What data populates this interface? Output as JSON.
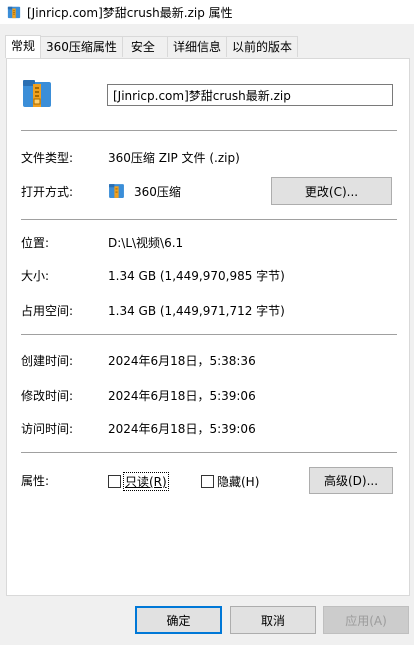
{
  "window": {
    "title": "[Jinricp.com]梦甜crush最新.zip 属性"
  },
  "tabs": [
    {
      "label": "常规",
      "active": true
    },
    {
      "label": "360压缩属性"
    },
    {
      "label": "安全"
    },
    {
      "label": "详细信息"
    },
    {
      "label": "以前的版本"
    }
  ],
  "general": {
    "filename": "[Jinricp.com]梦甜crush最新.zip",
    "file_type_label": "文件类型:",
    "file_type_value": "360压缩 ZIP 文件 (.zip)",
    "open_with_label": "打开方式:",
    "open_with_value": "360压缩",
    "change_button": "更改(C)...",
    "location_label": "位置:",
    "location_value": "D:\\L\\视频\\6.1",
    "size_label": "大小:",
    "size_value": "1.34 GB (1,449,970,985 字节)",
    "size_on_disk_label": "占用空间:",
    "size_on_disk_value": "1.34 GB (1,449,971,712 字节)",
    "created_label": "创建时间:",
    "created_value": "2024年6月18日，5:38:36",
    "modified_label": "修改时间:",
    "modified_value": "2024年6月18日，5:39:06",
    "accessed_label": "访问时间:",
    "accessed_value": "2024年6月18日，5:39:06",
    "attributes_label": "属性:",
    "readonly_label": "只读(R)",
    "readonly_checked": false,
    "hidden_label": "隐藏(H)",
    "hidden_checked": false,
    "advanced_button": "高级(D)..."
  },
  "footer": {
    "ok": "确定",
    "cancel": "取消",
    "apply": "应用(A)"
  },
  "icons": {
    "title_icon": "zip-archive-icon",
    "file_icon": "zip-archive-icon",
    "open_with_icon": "360zip-icon"
  },
  "colors": {
    "accent": "#0078d7",
    "zip_blue": "#3b8ed8",
    "zip_orange": "#f0a020"
  }
}
